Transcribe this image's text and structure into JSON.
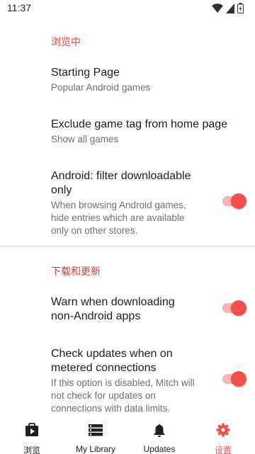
{
  "status_bar": {
    "time": "11:37",
    "icons": [
      "wifi-icon",
      "cellular-icon",
      "battery-icon"
    ]
  },
  "sections": [
    {
      "header": "浏览中",
      "items": [
        {
          "title": "Starting Page",
          "summary": "Popular Android games"
        },
        {
          "title": "Exclude game tag from home page",
          "summary": "Show all games"
        },
        {
          "title": "Android: filter downloadable only",
          "summary": "When browsing Android games, hide entries which are available only on other stores.",
          "toggle_on": true
        }
      ]
    },
    {
      "header": "下载和更新",
      "items": [
        {
          "title": "Warn when downloading non-Android apps",
          "toggle_on": true
        },
        {
          "title": "Check updates when on metered connections",
          "summary": "If this option is disabled, Mitch will not check for updates on connections with data limits.",
          "toggle_on": true
        }
      ]
    }
  ],
  "bottom_nav": {
    "items": [
      {
        "label": "浏览",
        "icon": "play-bag-icon",
        "active": false
      },
      {
        "label": "My Library",
        "icon": "library-list-icon",
        "active": false
      },
      {
        "label": "Updates",
        "icon": "bell-icon",
        "active": false
      },
      {
        "label": "设置",
        "icon": "gear-icon",
        "active": true
      }
    ]
  },
  "colors": {
    "accent": "#f44e4e",
    "accent_light": "#f8b3b3",
    "text_primary": "#202020",
    "text_secondary": "#707070"
  }
}
